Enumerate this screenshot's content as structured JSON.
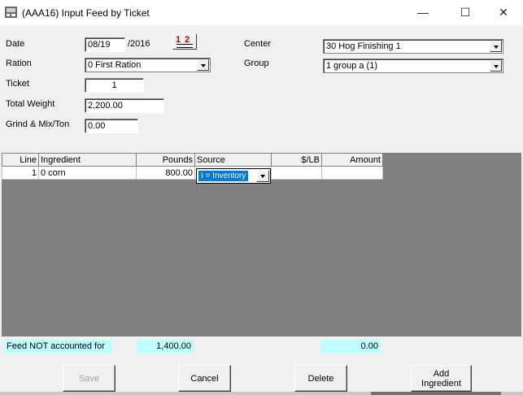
{
  "window": {
    "title": "(AAA16)  Input Feed by Ticket",
    "min_glyph": "—",
    "max_glyph": "☐",
    "close_glyph": "✕"
  },
  "form": {
    "date_label": "Date",
    "date_value": "08/19",
    "date_year": "/2016",
    "calendar_text": "1 2",
    "ration_label": "Ration",
    "ration_value": "0  First Ration",
    "ticket_label": "Ticket",
    "ticket_value": "1",
    "total_weight_label": "Total Weight",
    "total_weight_value": "2,200.00",
    "grind_label": "Grind & Mix/Ton",
    "grind_value": "0.00",
    "center_label": "Center",
    "center_value": "30  Hog Finishing 1",
    "group_label": "Group",
    "group_value": "1  group a  (1)"
  },
  "grid": {
    "headers": [
      "Line",
      "Ingredient",
      "Pounds",
      "Source",
      "$/LB",
      "Amount"
    ],
    "rows": [
      {
        "line": "1",
        "ingredient": "0  corn",
        "pounds": "800.00",
        "source": "I = Inventory",
        "price": "",
        "amount": ""
      }
    ]
  },
  "totals": {
    "unaccounted_label": "Feed NOT accounted for",
    "unaccounted_pounds": "1,400.00",
    "total_amount": "0.00"
  },
  "buttons": {
    "save": "Save",
    "cancel": "Cancel",
    "delete": "Delete",
    "add_ingredient_line1": "Add",
    "add_ingredient_line2": "Ingredient"
  },
  "colors": {
    "selection": "#0078d7",
    "highlight_cyan": "#bfffff",
    "calendar_red": "#c00000",
    "grid_background": "#808080"
  }
}
